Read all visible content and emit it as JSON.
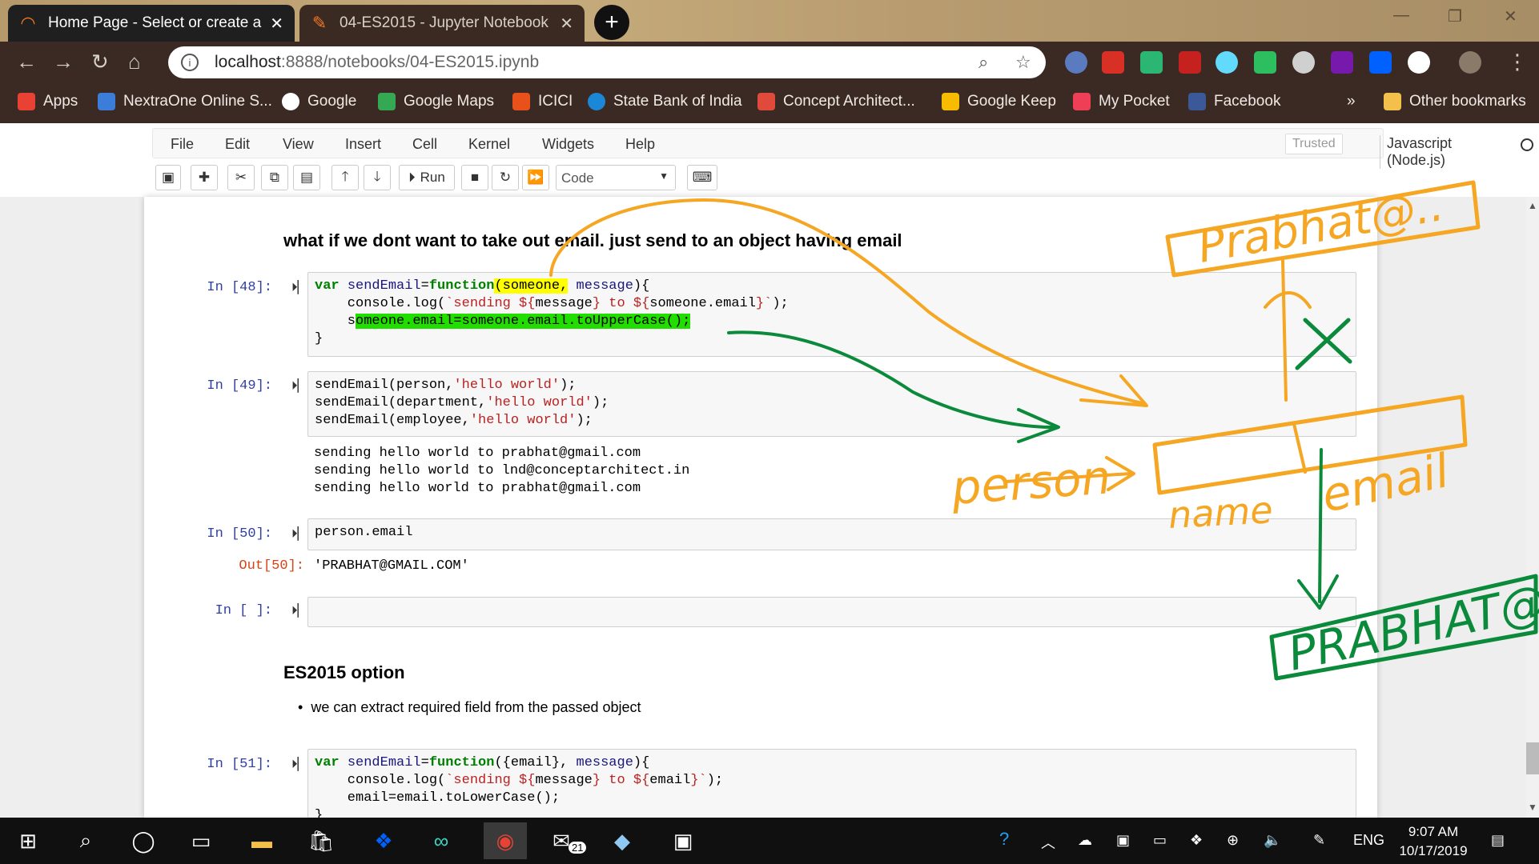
{
  "browser": {
    "tabs": [
      {
        "title": "Home Page - Select or create a n",
        "active": true
      },
      {
        "title": "04-ES2015 - Jupyter Notebook",
        "active": false
      }
    ],
    "url_host": "localhost",
    "url_path": ":8888/notebooks/04-ES2015.ipynb",
    "bookmarks": [
      {
        "label": "Apps",
        "icon": "apps-grid-icon",
        "color": "#e94235"
      },
      {
        "label": "NextraOne Online S...",
        "icon": "nextraone-icon",
        "color": "#3b7dd8"
      },
      {
        "label": "Google",
        "icon": "google-icon",
        "color": "#ffffff"
      },
      {
        "label": "Google Maps",
        "icon": "google-maps-icon",
        "color": "#34a853"
      },
      {
        "label": "ICICI",
        "icon": "icici-icon",
        "color": "#e8511a"
      },
      {
        "label": "State Bank of India",
        "icon": "sbi-icon",
        "color": "#1a88d6"
      },
      {
        "label": "Concept Architect...",
        "icon": "gmail-icon",
        "color": "#e04a3a"
      },
      {
        "label": "Google Keep",
        "icon": "google-keep-icon",
        "color": "#f7bb00"
      },
      {
        "label": "My Pocket",
        "icon": "pocket-icon",
        "color": "#ef3f56"
      },
      {
        "label": "Facebook",
        "icon": "facebook-icon",
        "color": "#3b5998"
      }
    ],
    "bookmarks_more": "»",
    "other_bookmarks": "Other bookmarks"
  },
  "jupyter": {
    "menu": [
      "File",
      "Edit",
      "View",
      "Insert",
      "Cell",
      "Kernel",
      "Widgets",
      "Help"
    ],
    "trusted": "Trusted",
    "kernel": "Javascript (Node.js)",
    "run_label": "Run",
    "cell_type": "Code"
  },
  "notebook": {
    "heading1": "what if we dont want to take out email. just send to an object having email",
    "cells": [
      {
        "prompt": "In [48]:"
      },
      {
        "prompt": "In [49]:"
      },
      {
        "prompt": "In [50]:",
        "out_prompt": "Out[50]:"
      },
      {
        "prompt": "In [ ]:"
      },
      {
        "prompt": "In [51]:"
      }
    ],
    "cell49_output": [
      "sending hello world to prabhat@gmail.com",
      "sending hello world to lnd@conceptarchitect.in",
      "sending hello world to prabhat@gmail.com"
    ],
    "cell50_code": "person.email",
    "cell50_output": "'PRABHAT@GMAIL.COM'",
    "heading2": "ES2015 option",
    "bullet": "we can extract required field from the passed object"
  },
  "annotations": {
    "orange_top": "Prabhat@..",
    "person": "person",
    "name": "name",
    "email": "email",
    "green_bottom": "PRABHAT@",
    "colors": {
      "orange": "#f5a623",
      "green": "#0a8a3a"
    }
  },
  "taskbar": {
    "time": "9:07 AM",
    "date": "10/17/2019",
    "lang": "ENG",
    "mail_badge": "21"
  }
}
